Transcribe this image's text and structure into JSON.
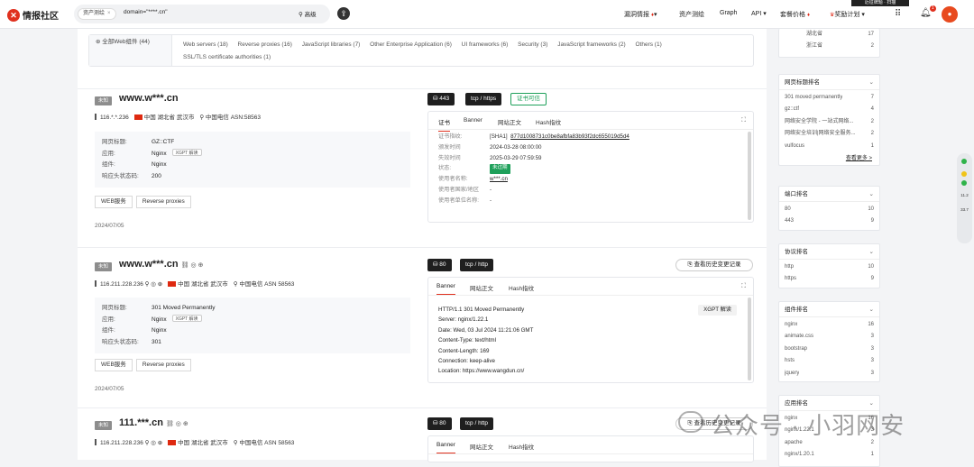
{
  "header": {
    "logo_text": "情报社区",
    "tab_label": "资产测绘",
    "tab_close": "×",
    "query": "domain=\"****.cn\"",
    "advanced": "高级",
    "nav": [
      "漏洞情报",
      "资产测绘",
      "Graph",
      "API",
      "套餐价格",
      "奖励计划"
    ],
    "notif_count": "1",
    "hat_text": "近征牌题 · 扫描"
  },
  "components": {
    "all": "全部Web组件 (44)",
    "items": [
      "Web servers (18)",
      "Reverse proxies (16)",
      "JavaScript libraries (7)",
      "Other Enterprise Application (6)",
      "UI frameworks (6)",
      "Security (3)",
      "JavaScript frameworks (2)",
      "Others (1)",
      "SSL/TLS certificate authorities (1)"
    ]
  },
  "cards": [
    {
      "badge": "未知",
      "host": "www.w***.cn",
      "ip": "116.*.*.236",
      "country": "中国",
      "province": "湖北省",
      "city": "武汉市",
      "isp": "中国电信",
      "asn": "ASN:58563",
      "info": [
        {
          "k": "网页标题:",
          "v": "GZ::CTF"
        },
        {
          "k": "应用:",
          "v": "Nginx",
          "x": "XGPT 解读"
        },
        {
          "k": "组件:",
          "v": "Nginx"
        },
        {
          "k": "响应头状态码:",
          "v": "200"
        }
      ],
      "tags": [
        "WEB服务",
        "Reverse proxies"
      ],
      "date": "2024/07/05",
      "port": "443",
      "proto": "tcp / https",
      "cert": "证书可信",
      "tabs": [
        "证书",
        "Banner",
        "网站正文",
        "Hash指纹"
      ],
      "certrows": [
        {
          "k": "证书指纹:",
          "v": "[SHA1]",
          "l": "877d1008731c0be8afbfa83b93f2dc655019d5d4"
        },
        {
          "k": "颁发时间",
          "v": "2024-03-28 08:00:00"
        },
        {
          "k": "失效时间",
          "v": "2025-03-29 07:59:59"
        },
        {
          "k": "状态:",
          "badge": "未过期"
        },
        {
          "k": "使用者名称:",
          "l": "w***.cn"
        },
        {
          "k": "使用者国家/地区",
          "v": "-"
        },
        {
          "k": "使用者单位名称:",
          "v": "-"
        }
      ]
    },
    {
      "badge": "未知",
      "host": "www.w***.cn",
      "ip": "116.211.228.236",
      "country": "中国",
      "province": "湖北省",
      "city": "武汉市",
      "isp": "中国电信",
      "asn": "ASN 58563",
      "info": [
        {
          "k": "网页标题:",
          "v": "301 Moved Permanently"
        },
        {
          "k": "应用:",
          "v": "Nginx",
          "x": "XGPT 解读"
        },
        {
          "k": "组件:",
          "v": "Nginx"
        },
        {
          "k": "响应头状态码:",
          "v": "301"
        }
      ],
      "tags": [
        "WEB服务",
        "Reverse proxies"
      ],
      "date": "2024/07/05",
      "port": "80",
      "proto": "tcp / http",
      "history": "查看历史变更记录",
      "tabs": [
        "Banner",
        "网站正文",
        "Hash指纹"
      ],
      "xgpt": "XGPT 解读",
      "banner": "HTTP/1.1 301 Moved Permanently\nServer: nginx/1.22.1\nDate: Wed, 03 Jul 2024 11:21:06 GMT\nContent-Type: text/html\nContent-Length: 169\nConnection: keep-alive\nLocation: https://www.wangdun.cn/"
    },
    {
      "badge": "未知",
      "host": "111.***.cn",
      "ip": "116.211.228.236",
      "country": "中国",
      "province": "湖北省",
      "city": "武汉市",
      "isp": "中国电信",
      "asn": "ASN 58563",
      "port": "80",
      "proto": "tcp / http",
      "history": "查看历史变更记录",
      "tabs": [
        "Banner",
        "网站正文",
        "Hash指纹"
      ]
    }
  ],
  "sidebar": {
    "top_rows": [
      [
        "湖北省",
        "17"
      ],
      [
        "浙江省",
        "2"
      ]
    ],
    "sections": [
      {
        "title": "网页标题排名",
        "rows": [
          [
            "301 moved permanently",
            "7"
          ],
          [
            "gz::ctf",
            "4"
          ],
          [
            "网络安全学院 - 一站式网络...",
            "2"
          ],
          [
            "网络安全培训|网络安全服务...",
            "2"
          ],
          [
            "vulfocus",
            "1"
          ]
        ],
        "more": "查看更多 >"
      },
      {
        "title": "端口排名",
        "rows": [
          [
            "80",
            "10"
          ],
          [
            "443",
            "9"
          ]
        ]
      },
      {
        "title": "协议排名",
        "rows": [
          [
            "http",
            "10"
          ],
          [
            "https",
            "9"
          ]
        ]
      },
      {
        "title": "组件排名",
        "rows": [
          [
            "nginx",
            "16"
          ],
          [
            "animate.css",
            "3"
          ],
          [
            "bootstrap",
            "3"
          ],
          [
            "hsts",
            "3"
          ],
          [
            "jquery",
            "3"
          ]
        ]
      },
      {
        "title": "应用排名",
        "rows": [
          [
            "nginx",
            "16"
          ],
          [
            "nginx/1.22.1",
            "3"
          ],
          [
            "apache",
            "2"
          ],
          [
            "nginx/1.20.1",
            "1"
          ]
        ]
      }
    ]
  },
  "float_widget": {
    "t1": "11.2",
    "t2": "33.7"
  },
  "watermark": "公众号 · 小羽网安",
  "colors": {
    "brand": "#e0301e",
    "green": "#1ea05a"
  }
}
